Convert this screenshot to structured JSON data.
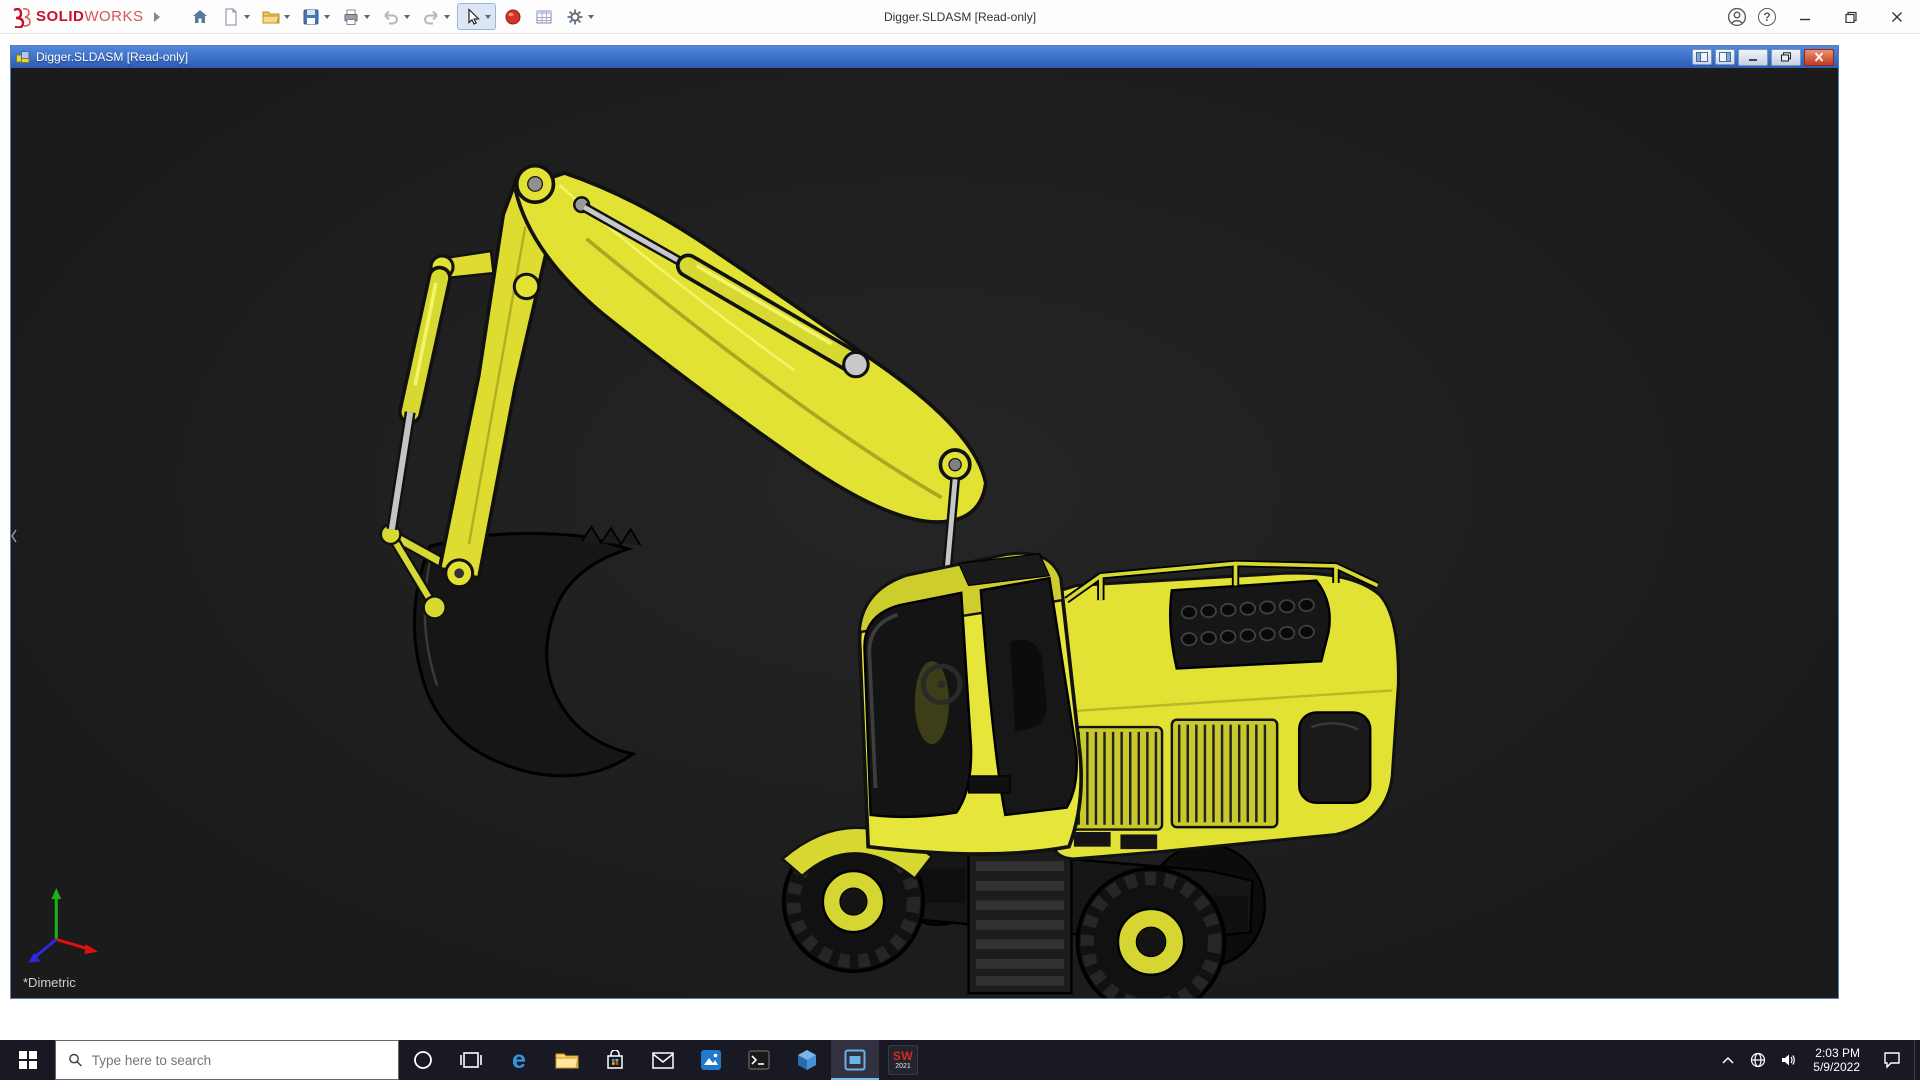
{
  "app": {
    "title": "Digger.SLDASM [Read-only]",
    "logo": {
      "solid": "SOLID",
      "works": "WORKS"
    }
  },
  "doc": {
    "title": "Digger.SLDASM [Read-only]"
  },
  "viewport": {
    "view_label": "*Dimetric"
  },
  "glyphs": {
    "help": "?"
  },
  "taskbar": {
    "search_placeholder": "Type here to search",
    "edge_letter": "e",
    "sw_app": {
      "line1": "SW",
      "line2": "2021"
    },
    "clock": {
      "time": "2:03 PM",
      "date": "5/9/2022"
    }
  },
  "colors": {
    "model_yellow": "#e6e63a",
    "viewport_bg": "#1e1e1e",
    "doc_titlebar_blue": "#3a6cc8",
    "taskbar_bg": "#191923",
    "close_red": "#d13c28"
  }
}
